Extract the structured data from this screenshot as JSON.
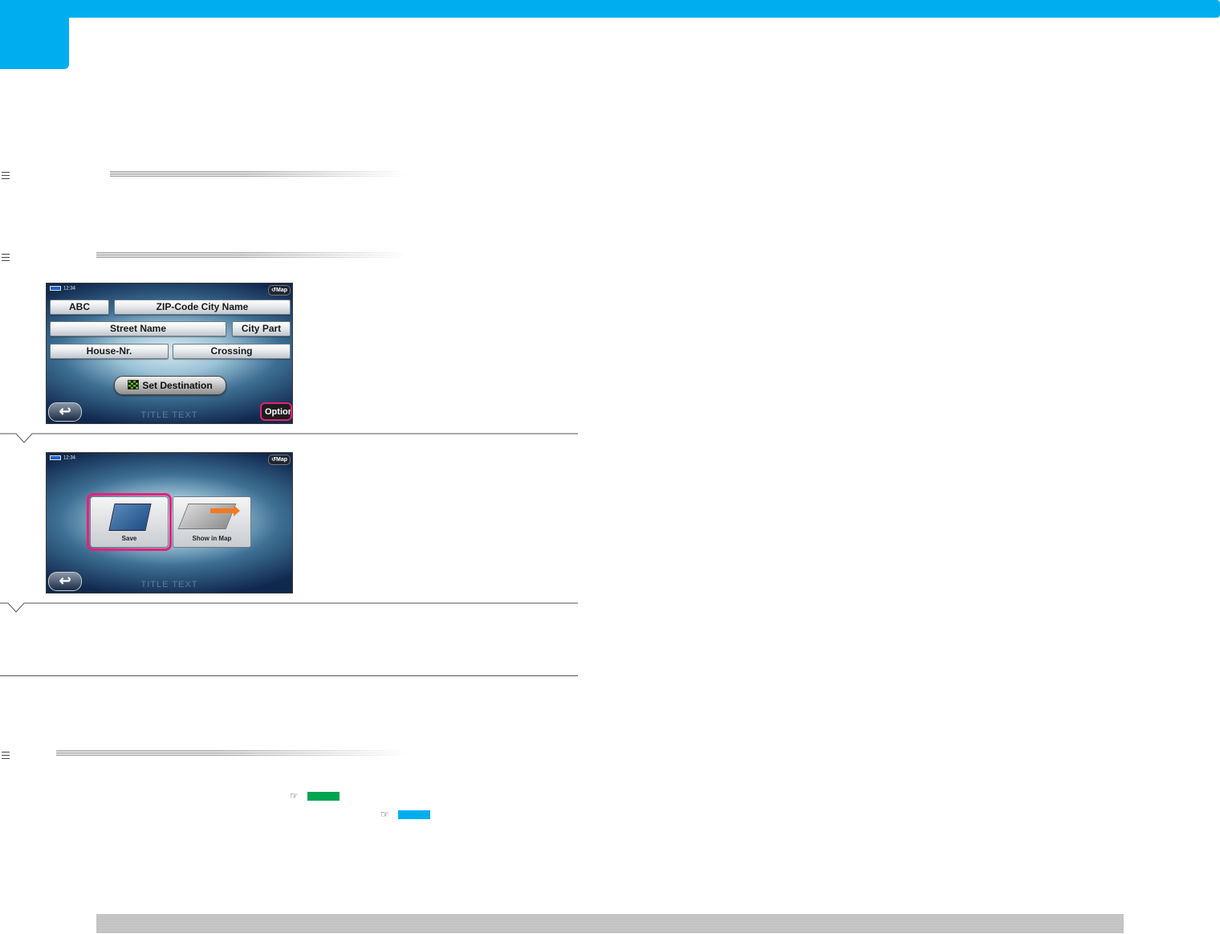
{
  "colors": {
    "accent_blue": "#00aeef",
    "highlight_pink": "#e7207a",
    "ref_green": "#00a54f",
    "ref_blue": "#00aeef"
  },
  "screen1": {
    "status_time": "12:34",
    "map_label": "Map",
    "buttons": [
      "ABC",
      "ZIP-Code City Name",
      "Street Name",
      "City Part",
      "House-Nr.",
      "Crossing"
    ],
    "set_destination_label": "Set Destination",
    "title_text": "TITLE TEXT",
    "options_label": "Option"
  },
  "screen2": {
    "status_time": "12:34",
    "map_label": "Map",
    "tiles": [
      {
        "label": "Save",
        "icon": "folder-icon",
        "highlighted": true
      },
      {
        "label": "Show in Map",
        "icon": "map-arrow-icon",
        "highlighted": false
      }
    ],
    "title_text": "TITLE TEXT"
  },
  "cross_refs": [
    {
      "icon": "pointing-hand-icon",
      "color": "#00a54f"
    },
    {
      "icon": "pointing-hand-icon",
      "color": "#00aeef"
    }
  ]
}
